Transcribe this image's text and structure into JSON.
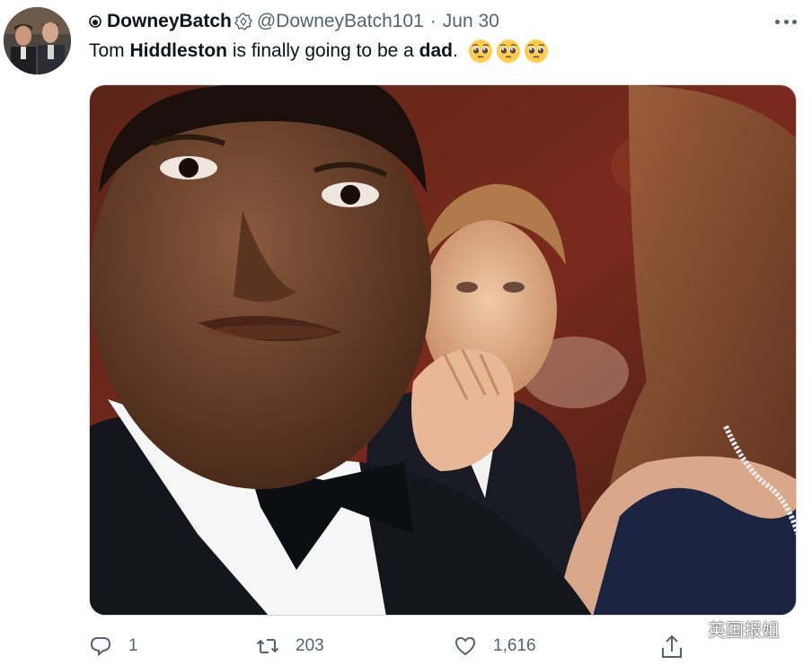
{
  "author": {
    "display_name": "DowneyBatch",
    "handle": "@DowneyBatch101",
    "separator": "·",
    "date": "Jun 30"
  },
  "tweet": {
    "text_before": "Tom ",
    "text_bold_1": "Hiddleston",
    "text_middle": " is finally going to be a ",
    "text_bold_2": "dad",
    "text_after": ".",
    "emoji": [
      "pleading-face",
      "pleading-face",
      "pleading-face"
    ]
  },
  "photo": {
    "type": "photo"
  },
  "actions": {
    "reply_count": "1",
    "retweet_count": "203",
    "like_count": "1,616"
  },
  "watermark": {
    "text": "英国报姐"
  },
  "colors": {
    "text_primary": "#0f1419",
    "text_secondary": "#536471",
    "border": "#cfd9de"
  }
}
